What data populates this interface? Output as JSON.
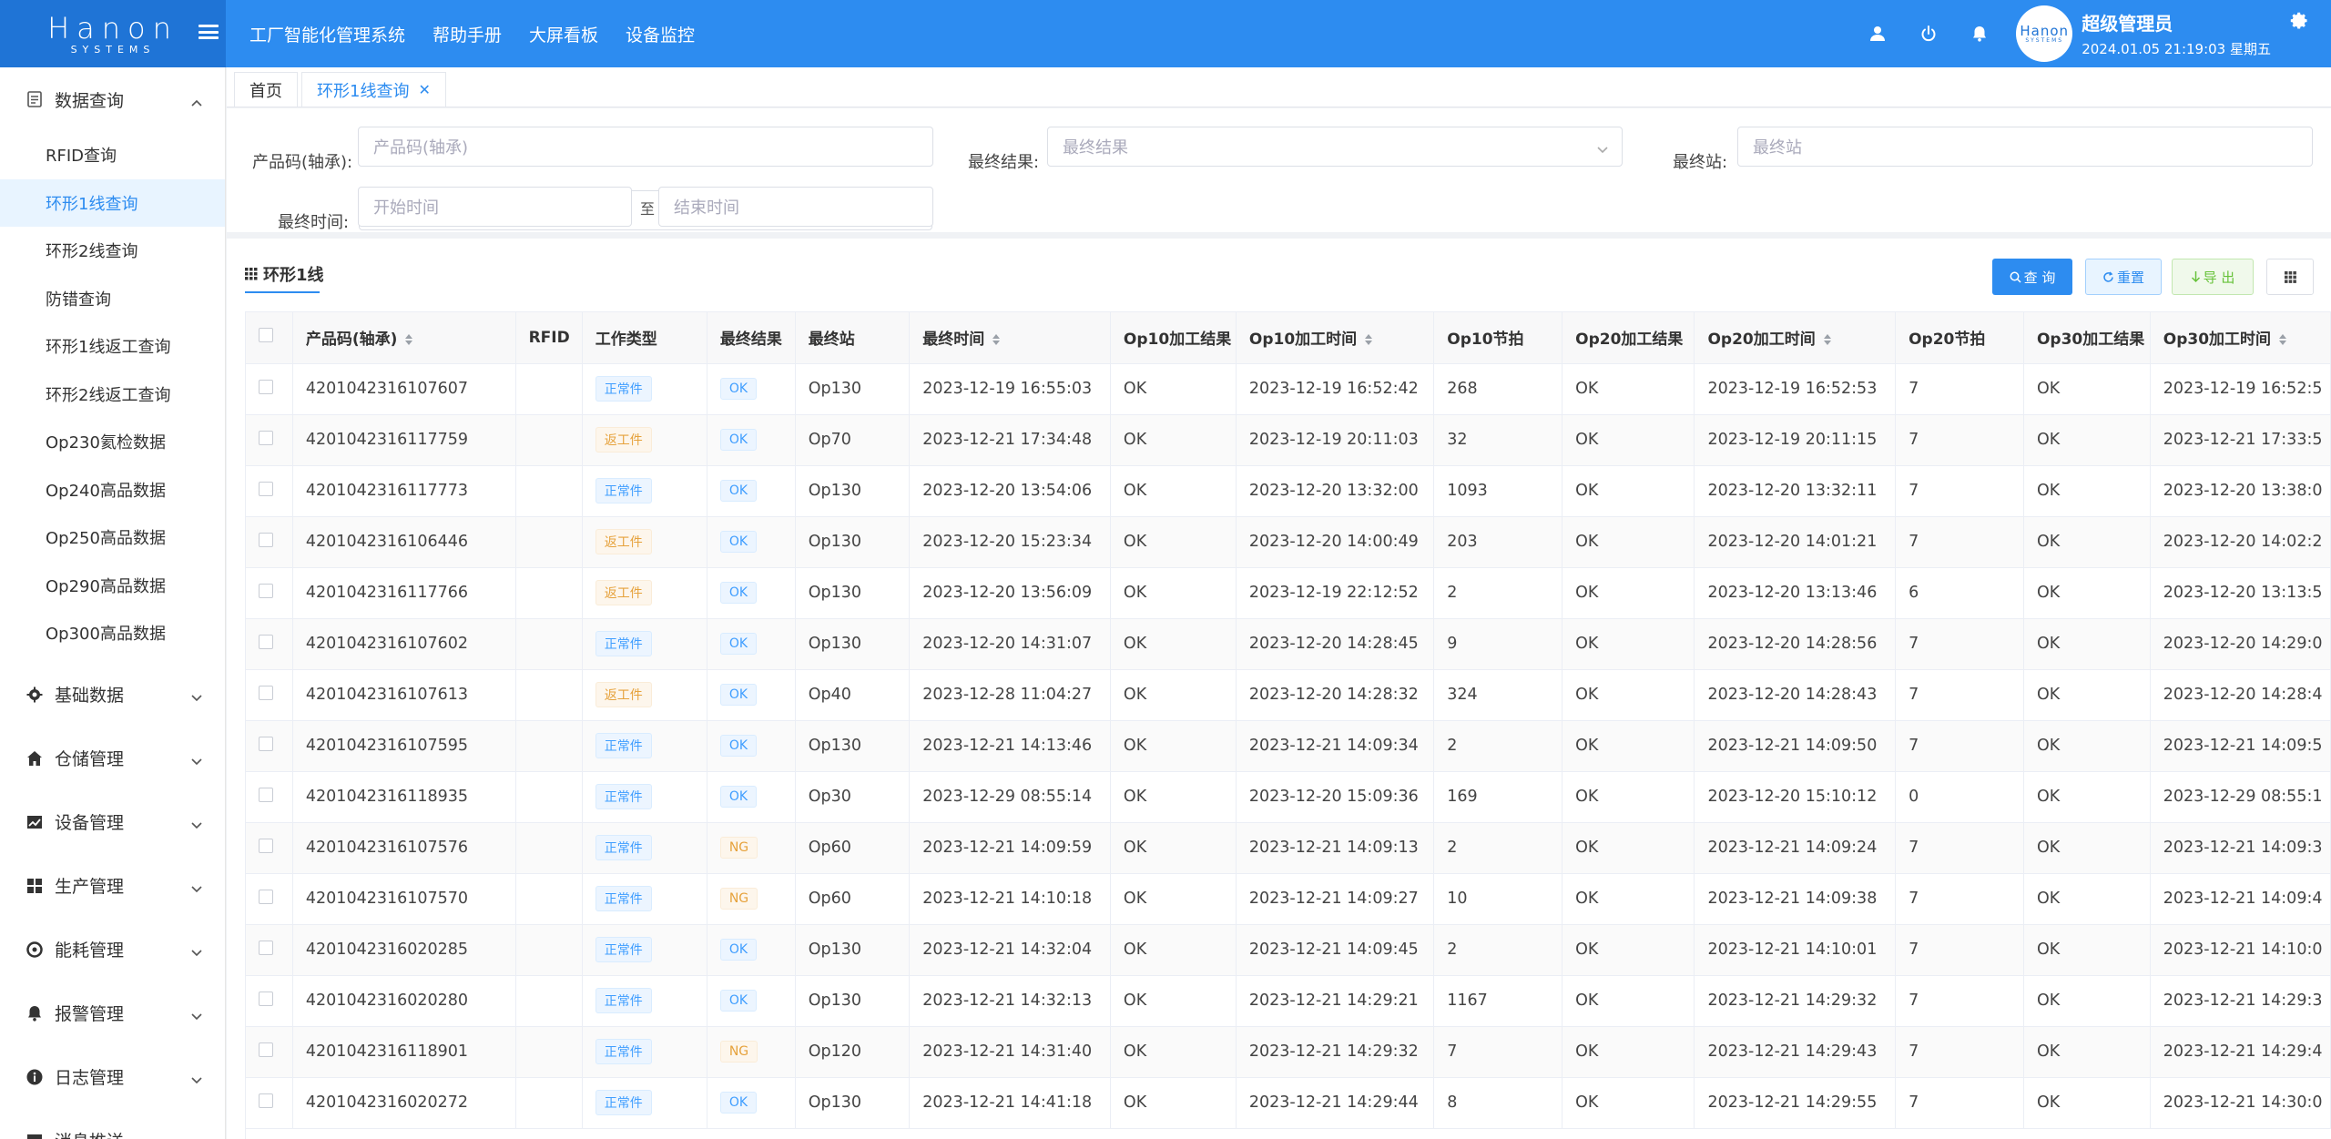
{
  "logo": {
    "main": "Hanon",
    "sub": "SYSTEMS",
    "avatar_main": "Hanon",
    "avatar_sub": "SYSTEMS"
  },
  "top_nav": [
    "工厂智能化管理系统",
    "帮助手册",
    "大屏看板",
    "设备监控"
  ],
  "user": {
    "name": "超级管理员",
    "datetime": "2024.01.05 21:19:03 星期五"
  },
  "sidebar": {
    "groups": [
      {
        "label": "数据查询",
        "icon": "document-icon",
        "expanded": true,
        "items": [
          "RFID查询",
          "环形1线查询",
          "环形2线查询",
          "防错查询",
          "环形1线返工查询",
          "环形2线返工查询",
          "Op230氦检数据",
          "Op240高品数据",
          "Op250高品数据",
          "Op290高品数据",
          "Op300高品数据"
        ],
        "active_index": 1
      },
      {
        "label": "基础数据",
        "icon": "gear-icon"
      },
      {
        "label": "仓储管理",
        "icon": "home-icon"
      },
      {
        "label": "设备管理",
        "icon": "chart-icon"
      },
      {
        "label": "生产管理",
        "icon": "grid-icon"
      },
      {
        "label": "能耗管理",
        "icon": "compass-icon"
      },
      {
        "label": "报警管理",
        "icon": "bell-icon"
      },
      {
        "label": "日志管理",
        "icon": "info-icon"
      },
      {
        "label": "消息推送",
        "icon": "message-icon"
      }
    ]
  },
  "tabs": [
    {
      "label": "首页",
      "active": false
    },
    {
      "label": "环形1线查询",
      "active": true,
      "closable": "✕"
    }
  ],
  "filters": {
    "product_code": {
      "label": "产品码(轴承):",
      "placeholder": "产品码(轴承)"
    },
    "final_result": {
      "label": "最终结果:",
      "placeholder": "最终结果"
    },
    "final_station": {
      "label": "最终站:",
      "placeholder": "最终站"
    },
    "final_time": {
      "label": "最终时间:",
      "start_placeholder": "开始时间",
      "to": "至",
      "end_placeholder": "结束时间"
    }
  },
  "panel": {
    "title": "环形1线",
    "buttons": {
      "search": "查 询",
      "reset": "重置",
      "export": "导 出"
    }
  },
  "table": {
    "headers": [
      "产品码(轴承)",
      "RFID",
      "工作类型",
      "最终结果",
      "最终站",
      "最终时间",
      "Op10加工结果",
      "Op10加工时间",
      "Op10节拍",
      "Op20加工结果",
      "Op20加工时间",
      "Op20节拍",
      "Op30加工结果",
      "Op30加工时间"
    ],
    "sortable": [
      true,
      false,
      false,
      false,
      false,
      true,
      false,
      true,
      false,
      false,
      true,
      false,
      false,
      true
    ],
    "rows": [
      [
        "4201042316107607",
        "",
        "正常件",
        "OK",
        "Op130",
        "2023-12-19 16:55:03",
        "OK",
        "2023-12-19 16:52:42",
        "268",
        "OK",
        "2023-12-19 16:52:53",
        "7",
        "OK",
        "2023-12-19 16:52:5"
      ],
      [
        "4201042316117759",
        "",
        "返工件",
        "OK",
        "Op70",
        "2023-12-21 17:34:48",
        "OK",
        "2023-12-19 20:11:03",
        "32",
        "OK",
        "2023-12-19 20:11:15",
        "7",
        "OK",
        "2023-12-21 17:33:5"
      ],
      [
        "4201042316117773",
        "",
        "正常件",
        "OK",
        "Op130",
        "2023-12-20 13:54:06",
        "OK",
        "2023-12-20 13:32:00",
        "1093",
        "OK",
        "2023-12-20 13:32:11",
        "7",
        "OK",
        "2023-12-20 13:38:0"
      ],
      [
        "4201042316106446",
        "",
        "返工件",
        "OK",
        "Op130",
        "2023-12-20 15:23:34",
        "OK",
        "2023-12-20 14:00:49",
        "203",
        "OK",
        "2023-12-20 14:01:21",
        "7",
        "OK",
        "2023-12-20 14:02:2"
      ],
      [
        "4201042316117766",
        "",
        "返工件",
        "OK",
        "Op130",
        "2023-12-20 13:56:09",
        "OK",
        "2023-12-19 22:12:52",
        "2",
        "OK",
        "2023-12-20 13:13:46",
        "6",
        "OK",
        "2023-12-20 13:13:5"
      ],
      [
        "4201042316107602",
        "",
        "正常件",
        "OK",
        "Op130",
        "2023-12-20 14:31:07",
        "OK",
        "2023-12-20 14:28:45",
        "9",
        "OK",
        "2023-12-20 14:28:56",
        "7",
        "OK",
        "2023-12-20 14:29:0"
      ],
      [
        "4201042316107613",
        "",
        "返工件",
        "OK",
        "Op40",
        "2023-12-28 11:04:27",
        "OK",
        "2023-12-20 14:28:32",
        "324",
        "OK",
        "2023-12-20 14:28:43",
        "7",
        "OK",
        "2023-12-20 14:28:4"
      ],
      [
        "4201042316107595",
        "",
        "正常件",
        "OK",
        "Op130",
        "2023-12-21 14:13:46",
        "OK",
        "2023-12-21 14:09:34",
        "2",
        "OK",
        "2023-12-21 14:09:50",
        "7",
        "OK",
        "2023-12-21 14:09:5"
      ],
      [
        "4201042316118935",
        "",
        "正常件",
        "OK",
        "Op30",
        "2023-12-29 08:55:14",
        "OK",
        "2023-12-20 15:09:36",
        "169",
        "OK",
        "2023-12-20 15:10:12",
        "0",
        "OK",
        "2023-12-29 08:55:1"
      ],
      [
        "4201042316107576",
        "",
        "正常件",
        "NG",
        "Op60",
        "2023-12-21 14:09:59",
        "OK",
        "2023-12-21 14:09:13",
        "2",
        "OK",
        "2023-12-21 14:09:24",
        "7",
        "OK",
        "2023-12-21 14:09:3"
      ],
      [
        "4201042316107570",
        "",
        "正常件",
        "NG",
        "Op60",
        "2023-12-21 14:10:18",
        "OK",
        "2023-12-21 14:09:27",
        "10",
        "OK",
        "2023-12-21 14:09:38",
        "7",
        "OK",
        "2023-12-21 14:09:4"
      ],
      [
        "4201042316020285",
        "",
        "正常件",
        "OK",
        "Op130",
        "2023-12-21 14:32:04",
        "OK",
        "2023-12-21 14:09:45",
        "2",
        "OK",
        "2023-12-21 14:10:01",
        "7",
        "OK",
        "2023-12-21 14:10:0"
      ],
      [
        "4201042316020280",
        "",
        "正常件",
        "OK",
        "Op130",
        "2023-12-21 14:32:13",
        "OK",
        "2023-12-21 14:29:21",
        "1167",
        "OK",
        "2023-12-21 14:29:32",
        "7",
        "OK",
        "2023-12-21 14:29:3"
      ],
      [
        "4201042316118901",
        "",
        "正常件",
        "NG",
        "Op120",
        "2023-12-21 14:31:40",
        "OK",
        "2023-12-21 14:29:32",
        "7",
        "OK",
        "2023-12-21 14:29:43",
        "7",
        "OK",
        "2023-12-21 14:29:4"
      ],
      [
        "4201042316020272",
        "",
        "正常件",
        "OK",
        "Op130",
        "2023-12-21 14:41:18",
        "OK",
        "2023-12-21 14:29:44",
        "8",
        "OK",
        "2023-12-21 14:29:55",
        "7",
        "OK",
        "2023-12-21 14:30:0"
      ]
    ]
  },
  "colors": {
    "primary": "#2d8cf0",
    "tag_normal": "#409eff",
    "tag_rework": "#e6a23c",
    "tag_ng": "#e6a23c",
    "export": "#67c23a"
  }
}
